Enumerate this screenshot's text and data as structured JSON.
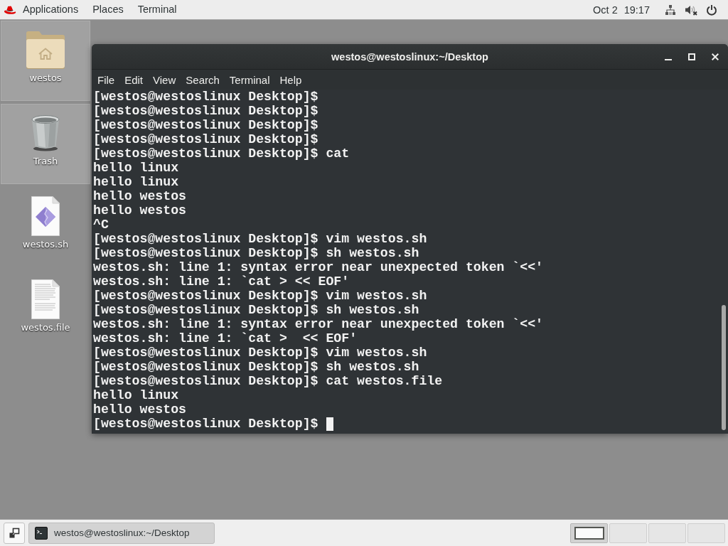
{
  "top_bar": {
    "menus": [
      "Applications",
      "Places",
      "Terminal"
    ],
    "date": "Oct 2",
    "time": "19:17"
  },
  "desktop_icons": [
    {
      "label": "westos",
      "kind": "home-folder",
      "selected": true
    },
    {
      "label": "Trash",
      "kind": "trash",
      "selected": true
    },
    {
      "label": "westos.sh",
      "kind": "script",
      "selected": false
    },
    {
      "label": "westos.file",
      "kind": "text-file",
      "selected": false
    }
  ],
  "terminal_window": {
    "title": "westos@westoslinux:~/Desktop",
    "menu": [
      "File",
      "Edit",
      "View",
      "Search",
      "Terminal",
      "Help"
    ],
    "lines": [
      "[westos@westoslinux Desktop]$",
      "[westos@westoslinux Desktop]$",
      "[westos@westoslinux Desktop]$",
      "[westos@westoslinux Desktop]$",
      "[westos@westoslinux Desktop]$ cat",
      "hello linux",
      "hello linux",
      "hello westos",
      "hello westos",
      "^C",
      "[westos@westoslinux Desktop]$ vim westos.sh",
      "[westos@westoslinux Desktop]$ sh westos.sh",
      "westos.sh: line 1: syntax error near unexpected token `<<'",
      "westos.sh: line 1: `cat > << EOF'",
      "[westos@westoslinux Desktop]$ vim westos.sh",
      "[westos@westoslinux Desktop]$ sh westos.sh",
      "westos.sh: line 1: syntax error near unexpected token `<<'",
      "westos.sh: line 1: `cat >  << EOF'",
      "[westos@westoslinux Desktop]$ vim westos.sh",
      "[westos@westoslinux Desktop]$ sh westos.sh",
      "[westos@westoslinux Desktop]$ cat westos.file",
      "hello linux",
      "hello westos",
      "[westos@westoslinux Desktop]$"
    ],
    "cursor": true
  },
  "taskbar": {
    "window_buttons": [
      {
        "label": "westos@westoslinux:~/Desktop",
        "active": true
      }
    ],
    "workspaces": [
      {
        "selected": true
      },
      {
        "selected": false
      },
      {
        "selected": false
      },
      {
        "selected": false
      }
    ]
  }
}
